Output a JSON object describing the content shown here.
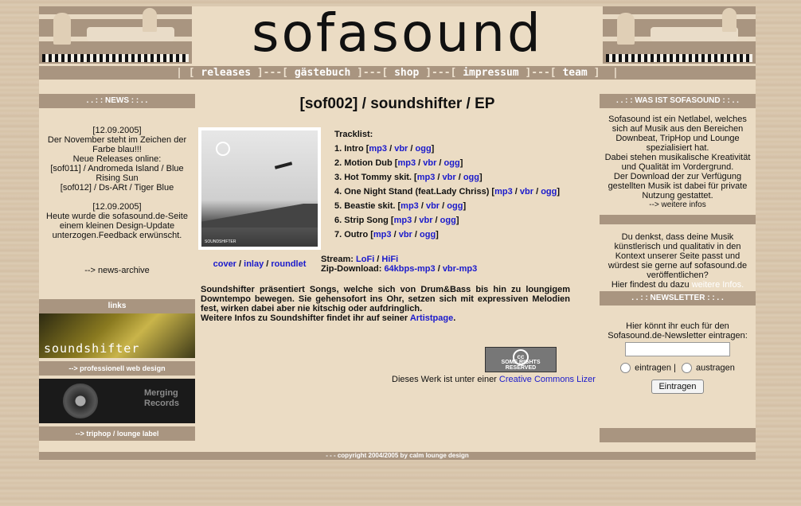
{
  "header": {
    "logo": "sofasound"
  },
  "nav": {
    "items": [
      "releases",
      "gästebuch",
      "shop",
      "impressum",
      "team"
    ]
  },
  "left": {
    "news_title": ". . : : NEWS : : . .",
    "news1_date": "[12.09.2005]",
    "news1_text1": "Der November steht im Zeichen der Farbe blau!!!",
    "news1_text2": "Neue Releases online:",
    "news1_text3": "[sof011] / Andromeda Island / Blue Rising Sun",
    "news1_text4": "[sof012] / Ds-ARt / Tiger Blue",
    "news2_date": "[12.09.2005]",
    "news2_text": "Heute wurde die sofasound.de-Seite einem kleinen Design-Update unterzogen.Feedback erwünscht.",
    "archive": "--> news-archive",
    "links_title": "links",
    "link1_caption": "--> professionell web design",
    "link1_logo": "soundshifter",
    "link2_caption": "--> triphop / lounge label",
    "link2_logo": "Merging Records"
  },
  "center": {
    "title": "[sof002] / soundshifter / EP",
    "tracklist_label": "Tracklist:",
    "tracks": [
      {
        "n": "1. Intro"
      },
      {
        "n": "2. Motion Dub"
      },
      {
        "n": "3. Hot Tommy skit."
      },
      {
        "n": "4. One Night Stand (feat.Lady Chriss)"
      },
      {
        "n": "5. Beastie skit."
      },
      {
        "n": "6. Strip Song"
      },
      {
        "n": "7. Outro"
      }
    ],
    "fmt_mp3": "mp3",
    "fmt_vbr": "vbr",
    "fmt_ogg": "ogg",
    "cover_link": "cover",
    "inlay_link": "inlay",
    "roundlet_link": "roundlet",
    "stream_label": "Stream:",
    "stream_lofi": "LoFi",
    "stream_hifi": "HiFi",
    "zip_label": "Zip-Download:",
    "zip_64": "64kbps-mp3",
    "zip_vbr": "vbr-mp3",
    "desc": "Soundshifter präsentiert Songs, welche sich von Drum&Bass bis hin zu loungigem Downtempo bewegen. Sie gehensofort ins Ohr, setzen sich mit expressiven Melodien fest, wirken dabei aber nie kitschig oder aufdringlich.",
    "desc2": "Weitere Infos zu Soundshifter findet ihr auf seiner",
    "artistpage": "Artistpage",
    "cc_badge": "SOME RIGHTS RESERVED",
    "cc_text": "Dieses Werk ist unter einer",
    "cc_link": "Creative Commons Lizer",
    "cover_caption": "SOUNDSHIFTER"
  },
  "right": {
    "about_title": ". . : : WAS IST SOFASOUND : : . .",
    "about_text": "Sofasound ist ein Netlabel, welches sich auf Musik aus den Bereichen Downbeat, TripHop und Lounge spezialisiert hat.",
    "about_text2": "Dabei stehen musikalische Kreativität und Qualität im Vordergrund.",
    "about_text3": "Der Download der zur Verfügung gestellten Musik ist dabei für private Nutzung gestattet.",
    "about_more": "--> weitere infos",
    "ask_text": "Du denkst, dass deine Musik künstlerisch und qualitativ in den Kontext unserer Seite passt und würdest sie gerne auf sofasound.de veröffentlichen?",
    "ask_text2": "Hier findest du dazu",
    "ask_link": "weitere Infos.",
    "nl_title": ". . : : NEWSLETTER : : . .",
    "nl_text": "Hier könnt ihr euch für den Sofasound.de-Newsletter eintragen:",
    "nl_opt1": "eintragen",
    "nl_opt2": "austragen",
    "nl_button": "Eintragen"
  },
  "footer": {
    "text": "- - - copyright 2004/2005 by calm lounge design"
  }
}
